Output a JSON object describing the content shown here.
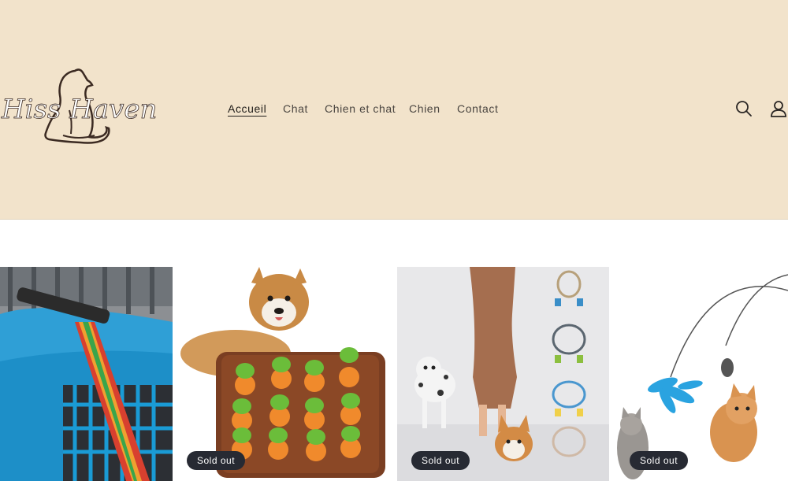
{
  "brand": {
    "logo_text": "Hiss Haven"
  },
  "nav": {
    "items": [
      {
        "label": "Accueil",
        "active": true
      },
      {
        "label": "Chat",
        "active": false
      },
      {
        "label": "Chien et chat",
        "active": false
      },
      {
        "label": "Chien",
        "active": false
      },
      {
        "label": "Contact",
        "active": false
      }
    ]
  },
  "header_icons": {
    "search": "search-icon",
    "account": "account-icon"
  },
  "products": [
    {
      "image": "blue pet carrier with rainbow strap",
      "badge": ""
    },
    {
      "image": "corgi with carrot snuffle mat toy",
      "badge": "Sold out"
    },
    {
      "image": "dog leashes and dogs",
      "badge": "Sold out"
    },
    {
      "image": "cat feather wand toy with cats",
      "badge": "Sold out"
    }
  ],
  "colors": {
    "header_bg": "#f2e3cb",
    "badge_bg": "#272a33",
    "text": "#4a4540"
  }
}
